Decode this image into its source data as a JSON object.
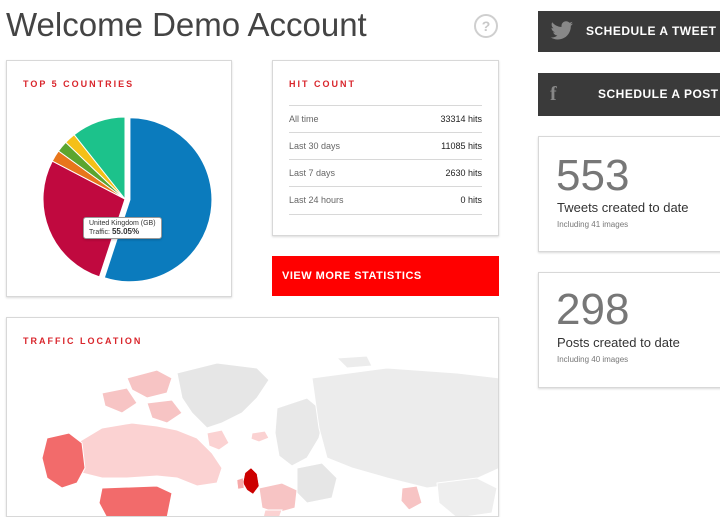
{
  "page": {
    "title": "Welcome Demo Account",
    "help_symbol": "?"
  },
  "countries_card": {
    "title": "TOP 5 COUNTRIES",
    "tooltip": {
      "country": "United Kingdom (GB)",
      "traffic_label": "Traffic:",
      "traffic_value": "55.05%"
    }
  },
  "chart_data": {
    "type": "pie",
    "title": "TOP 5 COUNTRIES",
    "slices": [
      {
        "label": "United Kingdom (GB)",
        "value": 55.05,
        "color": "#0b7bbd"
      },
      {
        "label": "",
        "value": 27.6,
        "color": "#c0093f"
      },
      {
        "label": "",
        "value": 2.3,
        "color": "#e8761b"
      },
      {
        "label": "",
        "value": 2.2,
        "color": "#5ba52f"
      },
      {
        "label": "",
        "value": 2.2,
        "color": "#f5c018"
      },
      {
        "label": "",
        "value": 10.65,
        "color": "#1cc28b"
      }
    ]
  },
  "hit_count": {
    "title": "HIT COUNT",
    "rows": [
      {
        "label": "All time",
        "value": "33314 hits"
      },
      {
        "label": "Last 30 days",
        "value": "11085 hits"
      },
      {
        "label": "Last 7 days",
        "value": "2630 hits"
      },
      {
        "label": "Last 24 hours",
        "value": "0 hits"
      }
    ]
  },
  "buttons": {
    "view_more": "VIEW MORE STATISTICS",
    "schedule_tweet": "SCHEDULE A TWEET",
    "schedule_post": "SCHEDULE A POST"
  },
  "traffic_card": {
    "title": "TRAFFIC LOCATION"
  },
  "tweets_stat": {
    "number": "553",
    "label": "Tweets created to date",
    "sub": "Including 41 images"
  },
  "posts_stat": {
    "number": "298",
    "label": "Posts created to date",
    "sub": "Including 40 images"
  },
  "colors": {
    "accent_red": "#ff0000",
    "title_red": "#d9262c",
    "dark_button": "#3a3a3a"
  },
  "icons": {
    "tweet": "twitter-bird-icon",
    "post": "facebook-f-icon",
    "help": "question-circle-icon"
  }
}
